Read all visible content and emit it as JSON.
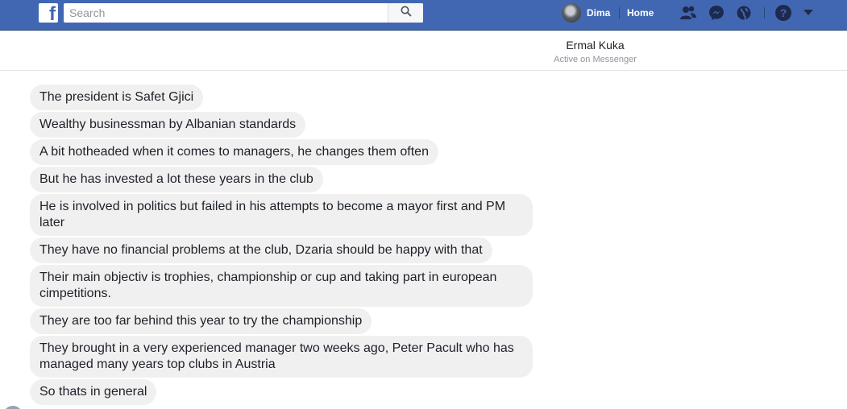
{
  "topbar": {
    "logo_letter": "f",
    "search_placeholder": "Search",
    "profile_name": "Dima",
    "home_label": "Home",
    "icons": [
      "friend-requests-icon",
      "messenger-icon",
      "notifications-globe-icon",
      "help-icon",
      "account-menu-caret-icon"
    ],
    "colors": {
      "bar": "#4267b2",
      "border": "#29487d"
    }
  },
  "conversation": {
    "name": "Ermal Kuka",
    "status": "Active on Messenger"
  },
  "messages": [
    {
      "text": "The president is Safet Gjici"
    },
    {
      "text": "Wealthy businessman by Albanian standards"
    },
    {
      "text": "A bit hotheaded when it comes to managers, he changes them often"
    },
    {
      "text": "But he has invested a lot these years in the club"
    },
    {
      "text": "He is involved in politics but failed in his attempts to become a mayor first and PM later"
    },
    {
      "text": "They have no financial problems at the club, Dzaria should be happy with that"
    },
    {
      "text": "Their main objectiv is trophies, championship or cup and taking part in european cimpetitions."
    },
    {
      "text": "They are too far behind this year to try the championship"
    },
    {
      "text": "They brought in a very experienced manager two weeks ago, Peter Pacult who has managed many years top clubs in Austria"
    },
    {
      "text": "So thats in general"
    }
  ],
  "bubble_color": "#f1f0f0"
}
